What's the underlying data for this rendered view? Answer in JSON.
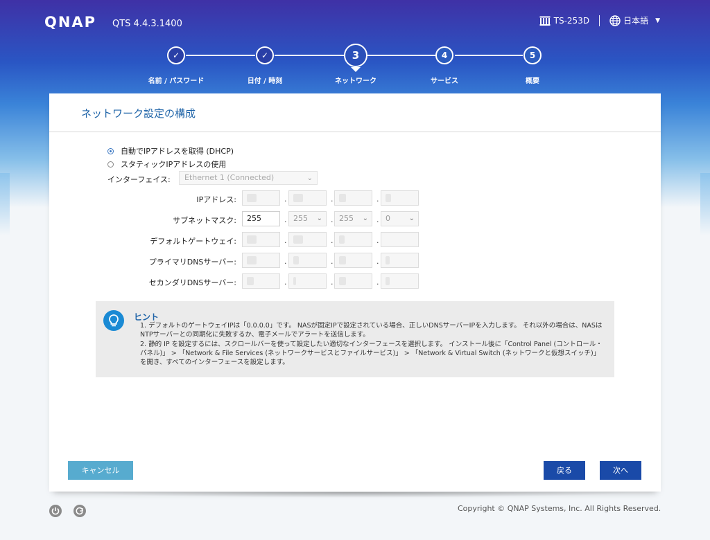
{
  "header": {
    "logo": "QNAP",
    "version": "QTS 4.4.3.1400",
    "device_icon": "nas-icon",
    "device_name": "TS-253D",
    "language_icon": "globe-icon",
    "language": "日本語"
  },
  "steps": [
    {
      "number": "✓",
      "label": "名前 / パスワード",
      "state": "done"
    },
    {
      "number": "✓",
      "label": "日付 / 時刻",
      "state": "done"
    },
    {
      "number": "3",
      "label": "ネットワーク",
      "state": "active"
    },
    {
      "number": "4",
      "label": "サービス",
      "state": "todo"
    },
    {
      "number": "5",
      "label": "概要",
      "state": "todo"
    }
  ],
  "panel": {
    "title": "ネットワーク設定の構成",
    "radio_dhcp": "自動でIPアドレスを取得 (DHCP)",
    "radio_static": "スタティックIPアドレスの使用",
    "selected_mode": "dhcp",
    "interface_label": "インターフェイス:",
    "interface_value": "Ethernet 1 (Connected)",
    "fields": [
      {
        "label": "IPアドレス:",
        "octets": [
          "",
          "",
          "",
          ""
        ]
      },
      {
        "label": "サブネットマスク:",
        "octets": [
          "255",
          "255",
          "255",
          "0"
        ]
      },
      {
        "label": "デフォルトゲートウェイ:",
        "octets": [
          "",
          "",
          "",
          ""
        ]
      },
      {
        "label": "プライマリDNSサーバー:",
        "octets": [
          "",
          "",
          "",
          ""
        ]
      },
      {
        "label": "セカンダリDNSサーバー:",
        "octets": [
          "",
          "",
          "",
          ""
        ]
      }
    ]
  },
  "hint": {
    "icon": "lightbulb-icon",
    "title": "ヒント",
    "items": [
      "1. デフォルトのゲートウェイIPは「0.0.0.0」です。 NASが固定IPで設定されている場合、正しいDNSサーバーIPを入力します。 それ以外の場合は、NASはNTPサーバーとの同期化に失敗するか、電子メールでアラートを送信します。",
      "2. 静的 IP を設定するには、スクロールバーを使って設定したい適切なインターフェースを選択します。 インストール後に「Control Panel (コントロール・パネル)」 > 「Network & File Services (ネットワークサービスとファイルサービス)」 > 「Network & Virtual Switch (ネットワークと仮想スイッチ)」を開き、すべてのインターフェースを設定します。"
    ]
  },
  "buttons": {
    "cancel": "キャンセル",
    "back": "戻る",
    "next": "次へ"
  },
  "footer": {
    "copyright": "Copyright © QNAP Systems, Inc. All Rights Reserved."
  },
  "colors": {
    "accent": "#1a4aa8",
    "cancel": "#57abcf",
    "title": "#1f64a8"
  }
}
